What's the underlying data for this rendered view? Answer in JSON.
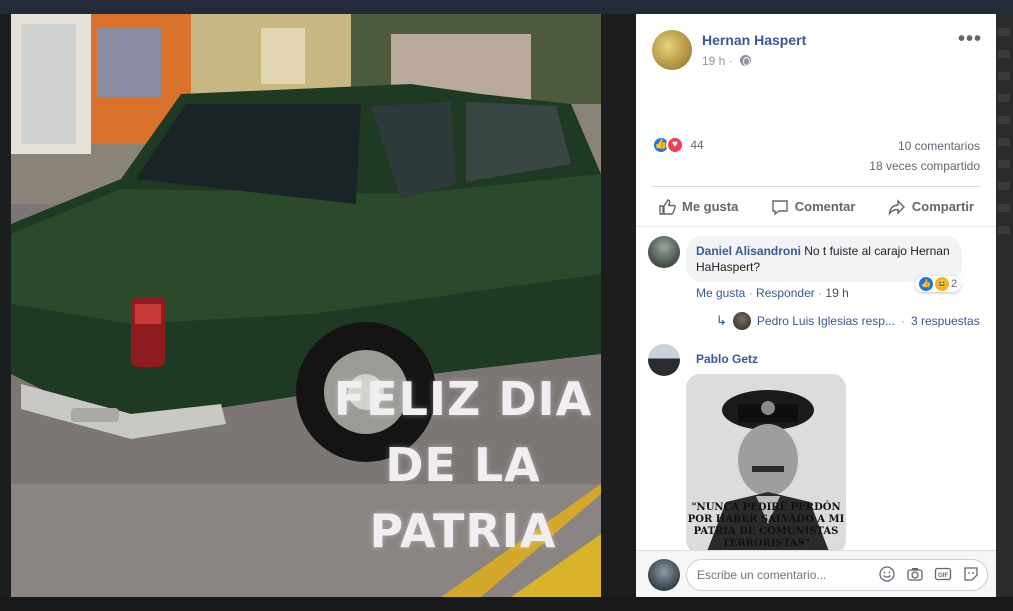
{
  "photo": {
    "caption_lines": [
      "FELIZ DIA",
      "DE LA",
      "PATRIA"
    ]
  },
  "post": {
    "author": "Hernan Haspert",
    "time": "19 h",
    "more_icon": "more-horizontal-icon",
    "reaction_count": "44",
    "comments_count": "10 comentarios",
    "shares_count": "18 veces compartido",
    "actions": {
      "like": "Me gusta",
      "comment": "Comentar",
      "share": "Compartir"
    }
  },
  "comments": [
    {
      "author": "Daniel Alisandroni",
      "text": "No t fuiste al carajo Hernan HaHaspert?",
      "reactions": "2",
      "like_link": "Me gusta",
      "reply_link": "Responder",
      "time": "19 h",
      "reply_author": "Pedro Luis Iglesias resp...",
      "reply_count": "3 respuestas"
    },
    {
      "author": "Pablo Getz",
      "sticker_text": "\"NUNCA PEDIRÉ PERDÓN POR HABER SALVADO A MI PATRIA DE COMUNISTAS TERRORISTAS\""
    }
  ],
  "composer": {
    "placeholder": "Escribe un comentario..."
  },
  "colors": {
    "link_blue": "#385898",
    "like_blue": "#1877f2",
    "love_red": "#f33e58"
  }
}
